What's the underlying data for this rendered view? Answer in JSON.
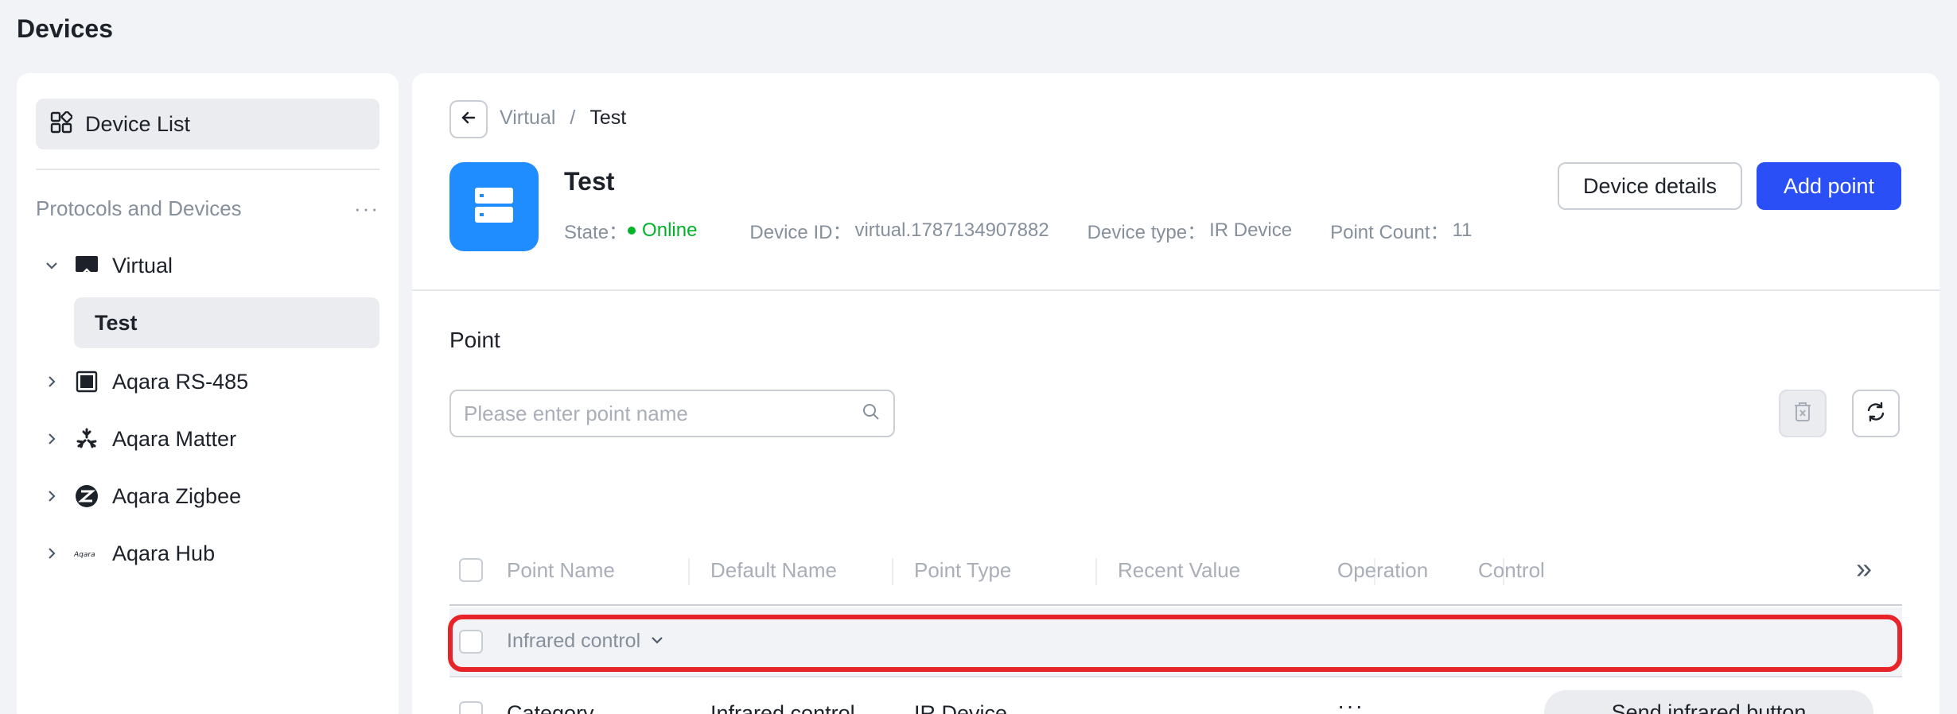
{
  "page_title": "Devices",
  "sidebar": {
    "device_list_label": "Device List",
    "section_title": "Protocols and Devices",
    "more_glyph": "···",
    "items": [
      {
        "label": "Virtual",
        "icon": "virtual-screen-icon",
        "expanded": true
      },
      {
        "label": "Aqara RS-485",
        "icon": "rs485-icon",
        "expanded": false
      },
      {
        "label": "Aqara Matter",
        "icon": "matter-icon",
        "expanded": false
      },
      {
        "label": "Aqara Zigbee",
        "icon": "zigbee-icon",
        "expanded": false
      },
      {
        "label": "Aqara Hub",
        "icon": "aqara-hub-logo-icon",
        "hub_logo_text": "Aqara",
        "expanded": false
      }
    ],
    "selected_child": "Test"
  },
  "breadcrumb": {
    "parent": "Virtual",
    "separator": "/",
    "current": "Test"
  },
  "device": {
    "name": "Test",
    "state_label": "State：",
    "state_value": "Online",
    "id_label": "Device ID：",
    "id_value": "virtual.1787134907882",
    "type_label": "Device type：",
    "type_value": "IR Device",
    "count_label": "Point Count：",
    "count_value": "11"
  },
  "actions": {
    "details_label": "Device details",
    "add_label": "Add point"
  },
  "point_section": {
    "title": "Point",
    "search_placeholder": "Please enter point name"
  },
  "table": {
    "headers": [
      "Point Name",
      "Default Name",
      "Point Type",
      "Recent Value",
      "Operation",
      "Control"
    ],
    "expand_glyph": "»",
    "group_label": "Infrared control",
    "rows": [
      {
        "point_name": "Category",
        "default_name": "Infrared control ...",
        "point_type": "IR Device",
        "recent_value": "",
        "operation": "···",
        "control_label": "Send infrared button"
      }
    ]
  },
  "colors": {
    "primary": "#2b4ff7",
    "online": "#00b42a",
    "avatar": "#1f8cff",
    "highlight": "#e8242b"
  }
}
